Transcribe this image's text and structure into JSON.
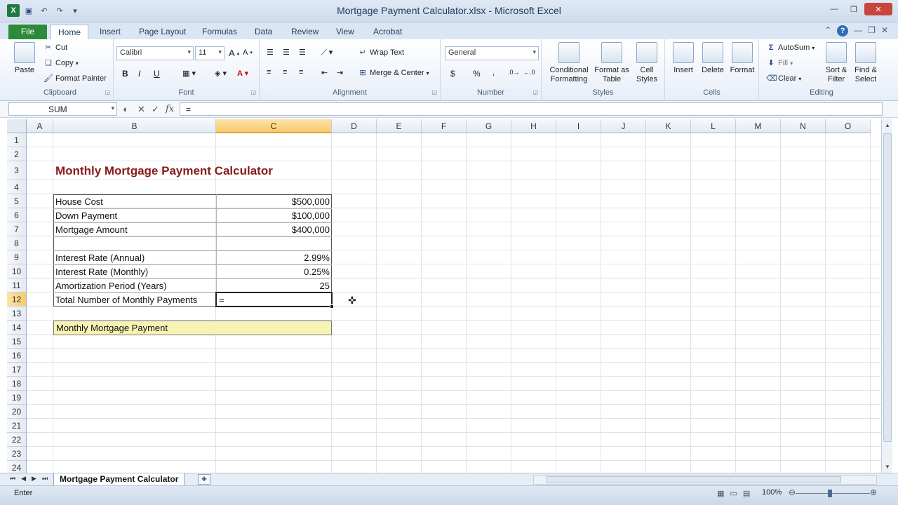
{
  "window": {
    "title": "Mortgage Payment Calculator.xlsx - Microsoft Excel"
  },
  "ribbon_tabs": [
    "File",
    "Home",
    "Insert",
    "Page Layout",
    "Formulas",
    "Data",
    "Review",
    "View",
    "Acrobat"
  ],
  "ribbon": {
    "clipboard": {
      "label": "Clipboard",
      "paste": "Paste",
      "cut": "Cut",
      "copy": "Copy",
      "format_painter": "Format Painter"
    },
    "font": {
      "label": "Font",
      "font_name": "Calibri",
      "font_size": "11",
      "bold": "B",
      "italic": "I",
      "underline": "U"
    },
    "alignment": {
      "label": "Alignment",
      "wrap_text": "Wrap Text",
      "merge_center": "Merge & Center"
    },
    "number": {
      "label": "Number",
      "format": "General",
      "currency": "$",
      "percent": "%",
      "comma": ","
    },
    "styles": {
      "label": "Styles",
      "conditional_formatting": "Conditional Formatting",
      "format_as_table": "Format as Table",
      "cell_styles": "Cell Styles"
    },
    "cells": {
      "label": "Cells",
      "insert": "Insert",
      "delete": "Delete",
      "format": "Format"
    },
    "editing": {
      "label": "Editing",
      "autosum": "AutoSum",
      "fill": "Fill",
      "clear": "Clear",
      "sort_filter": "Sort & Filter",
      "find_select": "Find & Select"
    }
  },
  "formula_bar": {
    "name_box": "SUM",
    "formula": "="
  },
  "columns": [
    "A",
    "B",
    "C",
    "D",
    "E",
    "F",
    "G",
    "H",
    "I",
    "J",
    "K",
    "L",
    "M",
    "N",
    "O"
  ],
  "rows": [
    "1",
    "2",
    "3",
    "4",
    "5",
    "6",
    "7",
    "8",
    "9",
    "10",
    "11",
    "12",
    "13",
    "14",
    "15",
    "16",
    "17",
    "18",
    "19",
    "20",
    "21",
    "22",
    "23",
    "24"
  ],
  "sheet": {
    "heading": "Monthly Mortgage Payment Calculator",
    "table": [
      {
        "label": "House Cost",
        "value": "$500,000"
      },
      {
        "label": "Down Payment",
        "value": "$100,000"
      },
      {
        "label": "Mortgage Amount",
        "value": "$400,000"
      },
      {
        "label": "",
        "value": ""
      },
      {
        "label": "Interest Rate (Annual)",
        "value": "2.99%"
      },
      {
        "label": "Interest Rate (Monthly)",
        "value": "0.25%"
      },
      {
        "label": "Amortization Period (Years)",
        "value": "25"
      },
      {
        "label": "Total Number of Monthly Payments",
        "value": "="
      }
    ],
    "payment_label": "Monthly Mortgage Payment",
    "active_cell": "C12"
  },
  "sheet_tabs": [
    "Mortgage Payment Calculator"
  ],
  "status": {
    "mode": "Enter",
    "zoom": "100%"
  },
  "colors": {
    "heading": "#8b1a1a",
    "highlight": "#f7f3b4",
    "file_tab": "#2c8a3a"
  }
}
